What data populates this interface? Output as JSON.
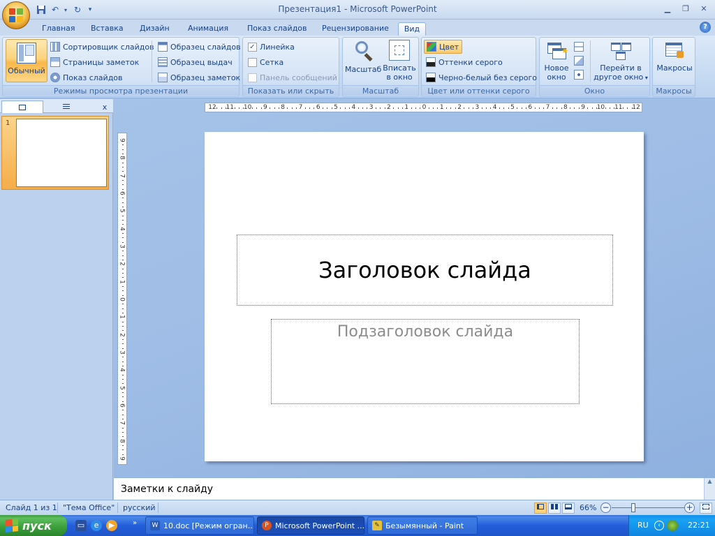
{
  "window": {
    "title": "Презентация1 - Microsoft PowerPoint"
  },
  "tabs": [
    {
      "label": "Главная"
    },
    {
      "label": "Вставка"
    },
    {
      "label": "Дизайн"
    },
    {
      "label": "Анимация"
    },
    {
      "label": "Показ слайдов"
    },
    {
      "label": "Рецензирование"
    },
    {
      "label": "Вид",
      "active": true
    }
  ],
  "ribbon": {
    "groups": {
      "views": "Режимы просмотра презентации",
      "show_hide": "Показать или скрыть",
      "zoom": "Масштаб",
      "color": "Цвет или оттенки серого",
      "window": "Окно",
      "macros": "Макросы"
    },
    "views": {
      "normal": "Обычный",
      "sorter": "Сортировщик слайдов",
      "notes_page": "Страницы заметок",
      "slide_show": "Показ слайдов",
      "slide_master": "Образец слайдов",
      "handout_master": "Образец выдач",
      "notes_master": "Образец заметок"
    },
    "show_hide": {
      "ruler": {
        "label": "Линейка",
        "checked": true
      },
      "grid": {
        "label": "Сетка",
        "checked": false
      },
      "message_bar": {
        "label": "Панель сообщений",
        "checked": false,
        "disabled": true
      }
    },
    "zoom": {
      "zoom": "Масштаб",
      "fit_line1": "Вписать",
      "fit_line2": "в окно"
    },
    "color": {
      "color": "Цвет",
      "grayscale": "Оттенки серого",
      "bw": "Черно-белый без серого"
    },
    "window": {
      "new_line1": "Новое",
      "new_line2": "окно",
      "switch_line1": "Перейти в",
      "switch_line2": "другое окно"
    },
    "macros": {
      "macros": "Макросы"
    }
  },
  "slides_panel": {
    "slide_number": "1"
  },
  "rulers": {
    "horizontal": [
      "12",
      "11",
      "10",
      "9",
      "8",
      "7",
      "6",
      "5",
      "4",
      "3",
      "2",
      "1",
      "0",
      "1",
      "2",
      "3",
      "4",
      "5",
      "6",
      "7",
      "8",
      "9",
      "10",
      "11",
      "12"
    ],
    "vertical": [
      "9",
      "8",
      "7",
      "6",
      "5",
      "4",
      "3",
      "2",
      "1",
      "0",
      "1",
      "2",
      "3",
      "4",
      "5",
      "6",
      "7",
      "8",
      "9"
    ]
  },
  "slide": {
    "title_placeholder": "Заголовок слайда",
    "subtitle_placeholder": "Подзаголовок слайда"
  },
  "notes": {
    "placeholder": "Заметки к слайду"
  },
  "status": {
    "slide": "Слайд 1 из 1",
    "theme": "\"Тема Office\"",
    "language": "русский",
    "zoom": "66%",
    "zoom_value": 66
  },
  "taskbar": {
    "start": "пуск",
    "tasks": [
      {
        "label": "10.doc [Режим огран...",
        "icon": "word-icon"
      },
      {
        "label": "Microsoft PowerPoint ...",
        "icon": "powerpoint-icon",
        "active": true
      },
      {
        "label": "Безымянный - Paint",
        "icon": "paint-icon"
      }
    ],
    "tray": {
      "language": "RU",
      "time": "22:21"
    }
  },
  "colors": {
    "office_orange": "#f5ad48",
    "ribbon_blue": "#dbe8f8",
    "taskbar_blue": "#245edb",
    "start_green": "#3a9d3a"
  }
}
